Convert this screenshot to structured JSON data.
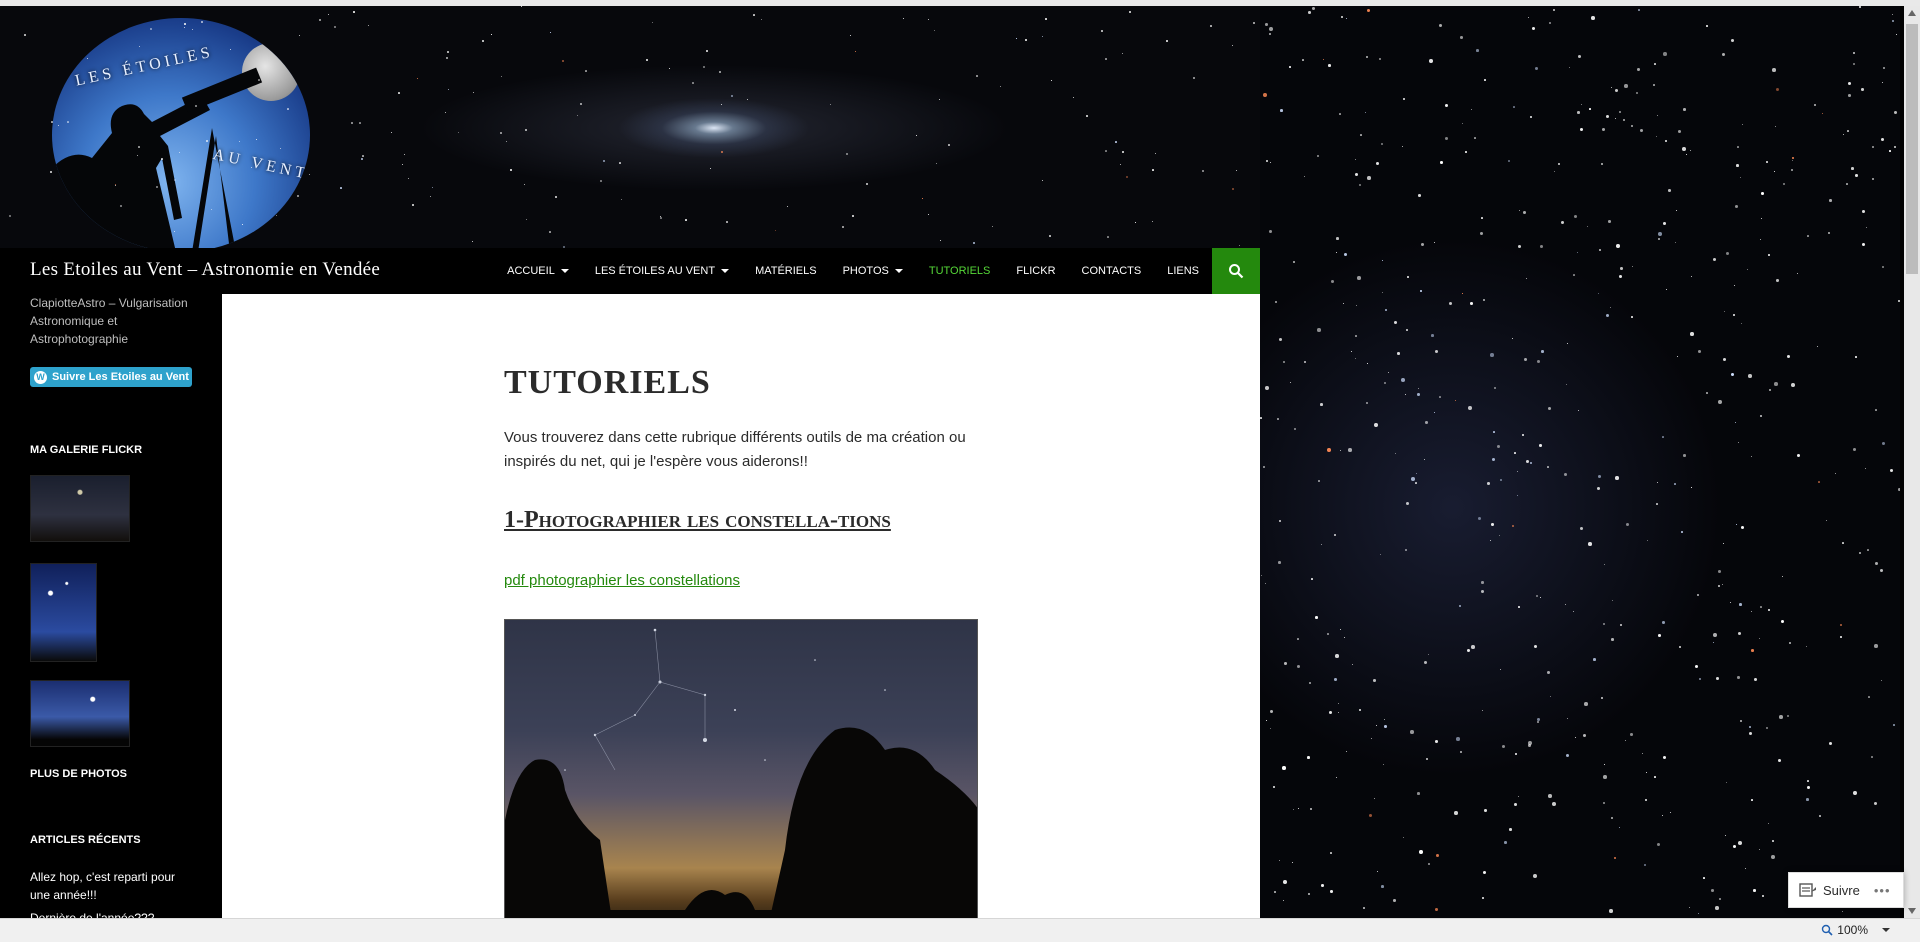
{
  "header": {
    "logo_text_top": "LES ÉTOILES",
    "logo_text_bottom": "AU VENT"
  },
  "site": {
    "title": "Les Etoiles au Vent – Astronomie en Vendée",
    "tagline": "ClapiotteAstro – Vulgarisation Astronomique et Astrophotographie"
  },
  "nav": {
    "items": [
      {
        "label": "Accueil",
        "dropdown": true,
        "active": false
      },
      {
        "label": "Les Étoiles au Vent",
        "dropdown": true,
        "active": false
      },
      {
        "label": "Matériels",
        "dropdown": false,
        "active": false
      },
      {
        "label": "Photos",
        "dropdown": true,
        "active": false
      },
      {
        "label": "Tutoriels",
        "dropdown": false,
        "active": true
      },
      {
        "label": "Flickr",
        "dropdown": false,
        "active": false
      },
      {
        "label": "Contacts",
        "dropdown": false,
        "active": false
      },
      {
        "label": "Liens",
        "dropdown": false,
        "active": false
      }
    ],
    "search_icon": "search-icon",
    "active_color": "#55d737",
    "search_bg": "#24890d"
  },
  "sidebar": {
    "follow_label": "Suivre Les Etoiles au Vent - A",
    "flickr_title": "Ma galerie Flickr",
    "more_photos": "Plus de photos",
    "recent_title": "Articles récents",
    "recent_posts": [
      "Allez hop, c'est reparti pour une année!!!",
      "Dernière de l'année???"
    ]
  },
  "main": {
    "title": "Tutoriels",
    "intro": "Vous trouverez dans cette rubrique différents outils de ma création ou inspirés du net, qui je l'espère vous aiderons!!",
    "section1_heading": "1-Photographier les constella-tions",
    "section1_link": "pdf photographier les constellations",
    "link_color": "#24890d"
  },
  "follow_widget": {
    "label": "Suivre",
    "more": "•••"
  },
  "statusbar": {
    "zoom": "100%"
  }
}
